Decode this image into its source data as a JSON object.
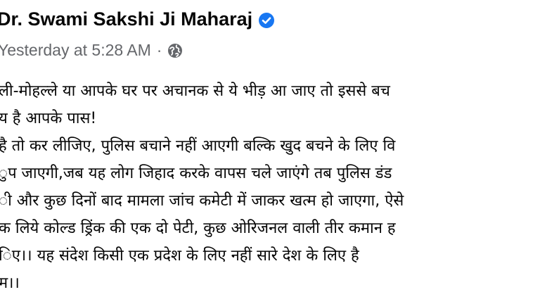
{
  "post": {
    "author": "Dr. Swami Sakshi Ji Maharaj",
    "verified_icon": "verified-badge-icon",
    "timestamp": "Yesterday at 5:28 AM",
    "separator": "·",
    "privacy_icon": "globe-icon",
    "body_lines": [
      "ली-मोहल्ले या आपके घर पर अचानक से ये भीड़  आ जाए तो इससे बच",
      "य है आपके पास!",
      " है तो कर लीजिए, पुलिस बचाने नहीं आएगी बल्कि खुद बचने के लिए वि",
      "ुप जाएगी,जब यह लोग जिहाद करके वापस चले जाएंगे तब पुलिस डंड",
      "ी और कुछ दिनों बाद मामला जांच कमेटी में जाकर खत्म हो जाएगा, ऐसे",
      "क लिये कोल्ड ड्रिंक की एक दो पेटी, कुछ ओरिजनल वाली तीर कमान ह",
      "िए।। यह संदेश किसी एक प्रदेश के लिए नहीं सारे देश के लिए है",
      "म।।"
    ],
    "colors": {
      "text": "#050505",
      "meta": "#65676b",
      "verified": "#1877f2"
    }
  }
}
